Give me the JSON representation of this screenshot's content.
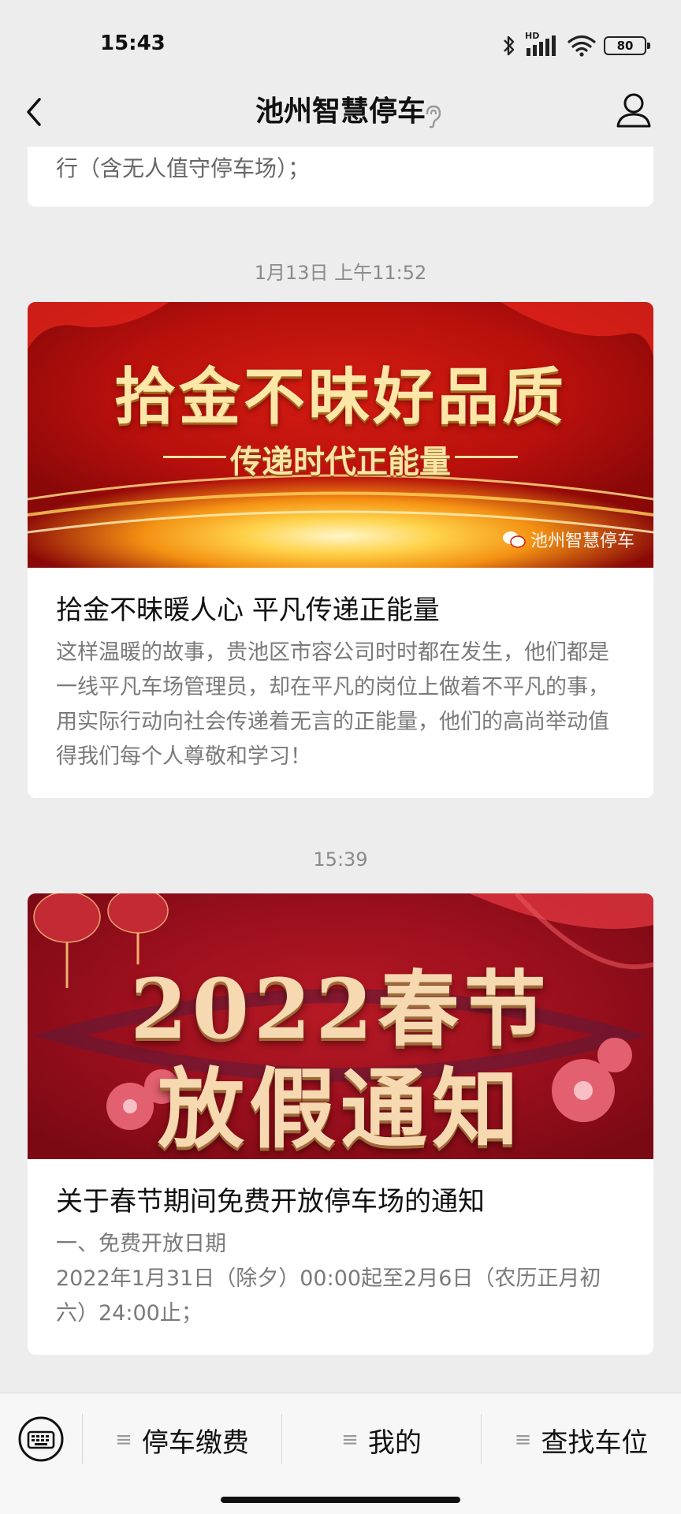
{
  "status_bar": {
    "time": "15:43",
    "network_label": "HD",
    "battery": "80",
    "icons": [
      "bluetooth-icon",
      "signal-icon",
      "wifi-icon",
      "battery-icon"
    ]
  },
  "nav": {
    "title": "池州智慧停车",
    "icons": [
      "back-icon",
      "ear-icon",
      "user-icon"
    ]
  },
  "feed": {
    "top_card_tail": "行（含无人值守停车场）；",
    "messages": [
      {
        "timestamp": "1月13日 上午11:52",
        "banner_title": "拾金不昧好品质",
        "banner_subtitle": "传递时代正能量",
        "banner_watermark": "池州智慧停车",
        "title": "拾金不昧暖人心 平凡传递正能量",
        "desc": "这样温暖的故事，贵池区市容公司时时都在发生，他们都是一线平凡车场管理员，却在平凡的岗位上做着不平凡的事，用实际行动向社会传递着无言的正能量，他们的高尚举动值得我们每个人尊敬和学习！"
      },
      {
        "timestamp": "15:39",
        "banner_title_line1": "2022春节",
        "banner_title_line2": "放假通知",
        "title": "关于春节期间免费开放停车场的通知",
        "desc_line1": "一、免费开放日期",
        "desc_line2": "2022年1月31日（除夕）00:00起至2月6日（农历正月初六）24:00止；"
      }
    ]
  },
  "bottom_menu": {
    "items": [
      "停车缴费",
      "我的",
      "查找车位"
    ],
    "icon": "≡"
  },
  "colors": {
    "background": "#ededed",
    "card": "#ffffff",
    "desc_text": "#7a7a7a",
    "banner_red": "#b8100c",
    "banner_gold": "#fde7a8"
  }
}
